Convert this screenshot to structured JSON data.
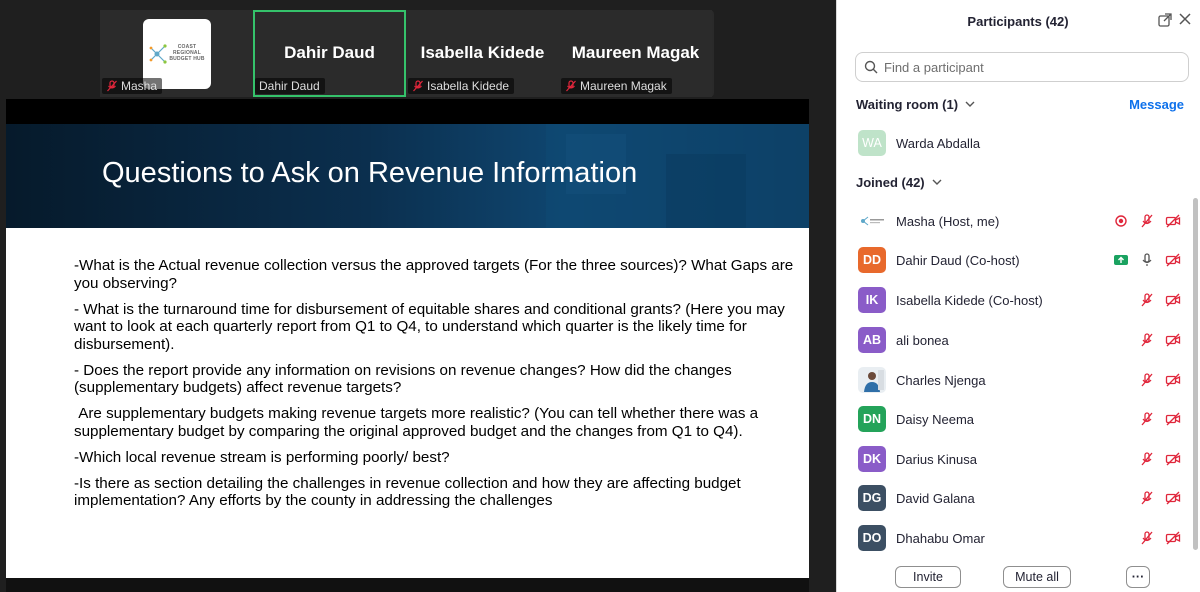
{
  "colors": {
    "accent_blue": "#0e71eb",
    "active_speaker": "#35c26b",
    "mute_red": "#e0263b",
    "share_green": "#1aa260"
  },
  "video_tiles": [
    {
      "label": "Masha",
      "muted": true,
      "logo_text": "COAST REGIONAL BUDGET HUB"
    },
    {
      "big_name": "Dahir Daud",
      "label": "Dahir Daud",
      "muted": false,
      "active": true
    },
    {
      "big_name": "Isabella Kidede",
      "label": "Isabella Kidede",
      "muted": true
    },
    {
      "big_name": "Maureen Magak",
      "label": "Maureen Magak",
      "muted": true
    }
  ],
  "slide": {
    "title": "Questions to Ask on Revenue Information",
    "questions": [
      "-What is the Actual revenue collection versus the approved targets (For the three sources)? What Gaps are you observing?",
      "- What is the turnaround time for disbursement of equitable shares and conditional grants? (Here you may want to look at each quarterly report from Q1 to Q4, to understand which quarter is the likely time for disbursement).",
      "- Does the report provide any information on revisions on revenue changes? How did the changes (supplementary budgets) affect revenue targets?",
      " Are supplementary budgets making revenue targets more realistic? (You can tell whether there was a supplementary budget by comparing the original approved budget and the changes from Q1 to Q4).",
      "-Which local revenue stream is performing poorly/ best?",
      "-Is there as section detailing the challenges in revenue collection and how they are affecting budget implementation? Any efforts by the county in addressing the challenges"
    ]
  },
  "panel": {
    "title": "Participants (42)",
    "search_placeholder": "Find a participant",
    "waiting_room": {
      "label": "Waiting room (1)",
      "action": "Message"
    },
    "waiting": [
      {
        "initials": "WA",
        "name": "Warda Abdalla",
        "color": "#bfe3c9"
      }
    ],
    "joined_label": "Joined (42)",
    "joined": [
      {
        "initials": "",
        "name": "Masha (Host, me)",
        "avatar": "logo",
        "icons": [
          "record-icon",
          "mic-muted-icon",
          "video-off-icon"
        ]
      },
      {
        "initials": "DD",
        "name": "Dahir Daud (Co-host)",
        "color": "#e8692c",
        "icons": [
          "share-screen-icon",
          "mic-icon",
          "video-off-icon"
        ]
      },
      {
        "initials": "IK",
        "name": "Isabella Kidede (Co-host)",
        "color": "#8a5cc8",
        "icons": [
          "mic-muted-icon",
          "video-off-icon"
        ]
      },
      {
        "initials": "AB",
        "name": "ali bonea",
        "color": "#8a5cc8",
        "icons": [
          "mic-muted-icon",
          "video-off-icon"
        ]
      },
      {
        "initials": "",
        "name": "Charles Njenga",
        "avatar": "photo",
        "icons": [
          "mic-muted-icon",
          "video-off-icon"
        ]
      },
      {
        "initials": "DN",
        "name": "Daisy Neema",
        "color": "#24a35a",
        "icons": [
          "mic-muted-icon",
          "video-off-icon"
        ]
      },
      {
        "initials": "DK",
        "name": "Darius Kinusa",
        "color": "#8a5cc8",
        "icons": [
          "mic-muted-icon",
          "video-off-icon"
        ]
      },
      {
        "initials": "DG",
        "name": "David Galana",
        "color": "#3c4f63",
        "icons": [
          "mic-muted-icon",
          "video-off-icon"
        ]
      },
      {
        "initials": "DO",
        "name": "Dhahabu Omar",
        "color": "#3c4f63",
        "icons": [
          "mic-muted-icon",
          "video-off-icon"
        ]
      }
    ],
    "footer": {
      "invite": "Invite",
      "mute_all": "Mute all",
      "more": "···"
    }
  }
}
